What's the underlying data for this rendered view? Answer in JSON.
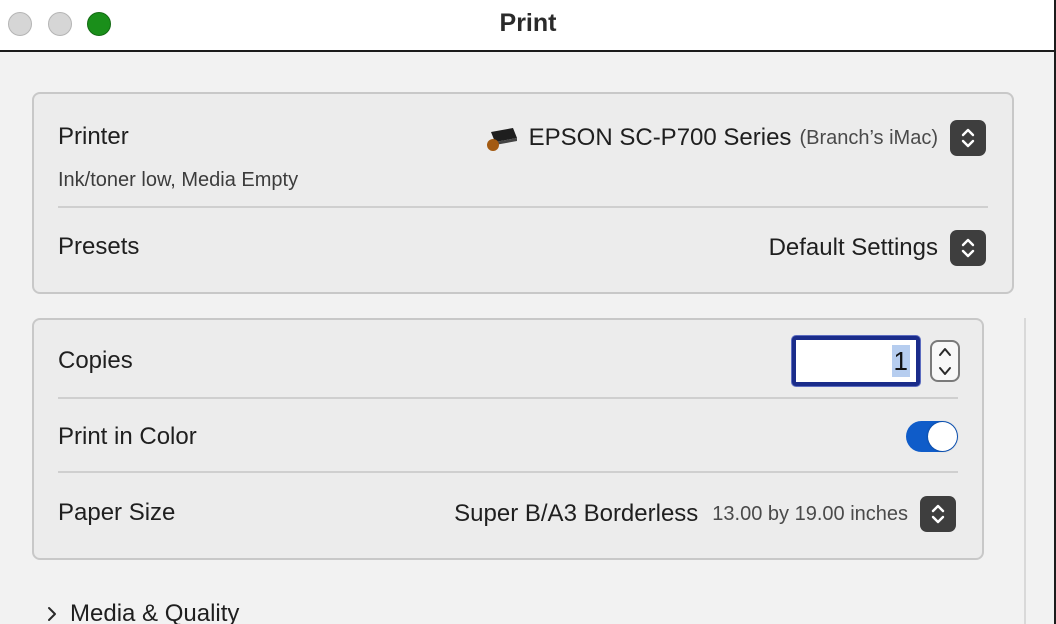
{
  "window": {
    "title": "Print"
  },
  "printer_panel": {
    "printer": {
      "label": "Printer",
      "status": "Ink/toner low, Media Empty",
      "name": "EPSON SC-P700 Series",
      "location": "(Branch’s iMac)",
      "icon": "printer-icon"
    },
    "presets": {
      "label": "Presets",
      "value": "Default Settings"
    }
  },
  "settings_panel": {
    "copies": {
      "label": "Copies",
      "value": "1"
    },
    "print_in_color": {
      "label": "Print in Color",
      "enabled": true,
      "accent": "#0f5cc9"
    },
    "paper_size": {
      "label": "Paper Size",
      "value": "Super B/A3 Borderless",
      "dimensions": "13.00 by 19.00 inches"
    }
  },
  "sections": {
    "media_quality": {
      "label": "Media & Quality"
    }
  }
}
